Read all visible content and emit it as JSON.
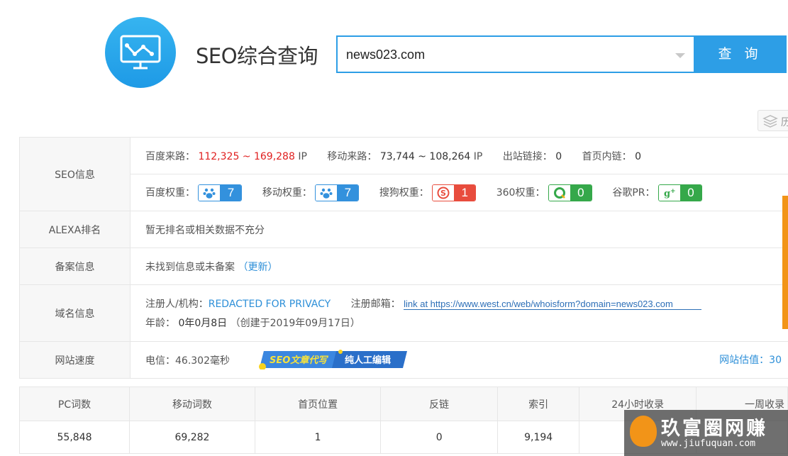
{
  "header": {
    "title": "SEO综合查询",
    "search_value": "news023.com",
    "search_button": "查 询",
    "history_label": "历"
  },
  "seo_info": {
    "label": "SEO信息",
    "baidu_traffic_label": "百度来路：",
    "baidu_traffic_value": "112,325 ~ 169,288",
    "ip_unit": "IP",
    "mobile_traffic_label": "移动来路：",
    "mobile_traffic_value": "73,744 ~ 108,264",
    "outbound_label": "出站链接：",
    "outbound_value": "0",
    "internal_label": "首页内链：",
    "internal_value": "0",
    "baidu_weight_label": "百度权重：",
    "baidu_weight": "7",
    "mobile_weight_label": "移动权重：",
    "mobile_weight": "7",
    "sogou_weight_label": "搜狗权重：",
    "sogou_weight": "1",
    "w360_label": "360权重：",
    "w360": "0",
    "google_label": "谷歌PR：",
    "google": "0"
  },
  "alexa": {
    "label": "ALEXA排名",
    "value": "暂无排名或相关数据不充分"
  },
  "beian": {
    "label": "备案信息",
    "value": "未找到信息或未备案",
    "update_link": "（更新）"
  },
  "domain": {
    "label": "域名信息",
    "registrant_label": "注册人/机构：",
    "registrant_value": "REDACTED FOR PRIVACY",
    "email_label": "注册邮箱：",
    "email_link": "link at https://www.west.cn/web/whoisform?domain=news023.com",
    "age_label": "年龄：",
    "age_value": "0年0月8日",
    "created": "（创建于2019年09月17日）"
  },
  "speed": {
    "label": "网站速度",
    "value": "电信：46.302毫秒",
    "banner_text1": "SEO文章代写",
    "banner_text2": "纯人工编辑",
    "estimate": "网站估值：30"
  },
  "stats": {
    "headers": [
      "PC词数",
      "移动词数",
      "首页位置",
      "反链",
      "索引",
      "24小时收录",
      "一周收录"
    ],
    "values": [
      "55,848",
      "69,282",
      "1",
      "0",
      "9,194",
      "",
      ""
    ]
  },
  "watermark": {
    "title": "玖富圈网赚",
    "url": "www.jiufuquan.com"
  }
}
